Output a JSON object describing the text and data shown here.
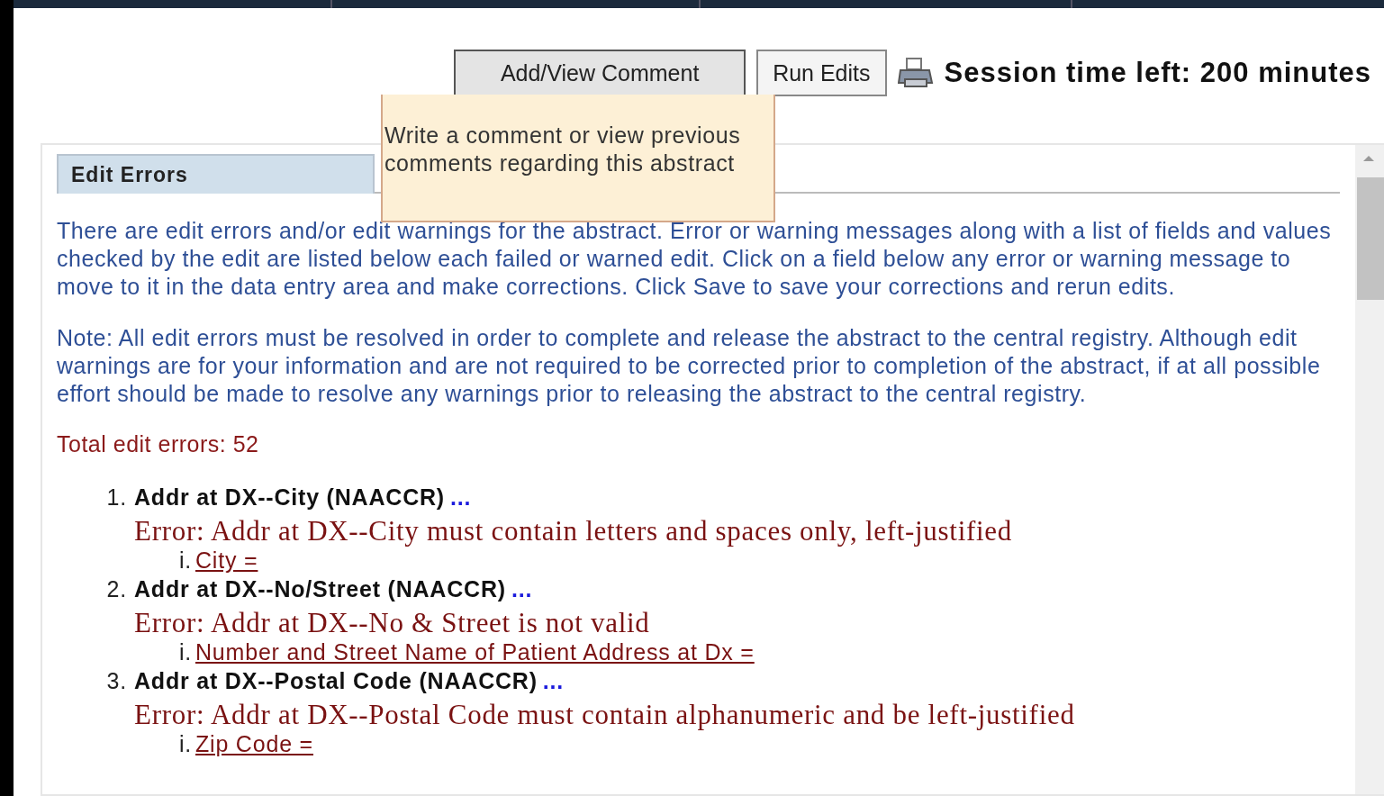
{
  "toolbar": {
    "buttons": [
      {
        "label": "Add/View Comment",
        "hovered": true
      },
      {
        "label": "Run Edits",
        "hovered": false
      }
    ],
    "session_text": "Session time left: 200 minutes"
  },
  "tooltip": {
    "text": "Write a comment or view previous comments regarding this abstract"
  },
  "panel": {
    "tab": {
      "label": "Edit Errors",
      "selected": true
    },
    "paragraphs": [
      "There are edit errors and/or edit warnings for the abstract. Error or warning messages along with a list of fields and values checked by the edit are listed below each failed or warned edit. Click on a field below any error or warning message to move to it in the data entry area and make corrections. Click Save to save your corrections and rerun edits.",
      "Note: All edit errors must be resolved in order to complete and release the abstract to the central registry. Although edit warnings are for your information and are not required to be corrected prior to completion of the abstract, if at all possible effort should be made to resolve any warnings prior to releasing the abstract to the central registry."
    ],
    "total": "Total edit errors: 52",
    "errors": [
      {
        "number": "1.",
        "title": "Addr at DX--City (NAACCR)",
        "more": "...",
        "message": "Error: Addr at DX--City must contain letters and spaces only, left-justified",
        "fields": [
          {
            "marker": "i.",
            "label": "City ="
          }
        ]
      },
      {
        "number": "2.",
        "title": "Addr at DX--No/Street (NAACCR)",
        "more": "...",
        "message": "Error: Addr at DX--No & Street is not valid",
        "fields": [
          {
            "marker": "i.",
            "label": "Number and Street Name of Patient Address at Dx ="
          }
        ]
      },
      {
        "number": "3.",
        "title": "Addr at DX--Postal Code (NAACCR)",
        "more": "...",
        "message": "Error: Addr at DX--Postal Code must contain alphanumeric and be left-justified",
        "fields": [
          {
            "marker": "i.",
            "label": "Zip Code ="
          }
        ]
      }
    ]
  }
}
